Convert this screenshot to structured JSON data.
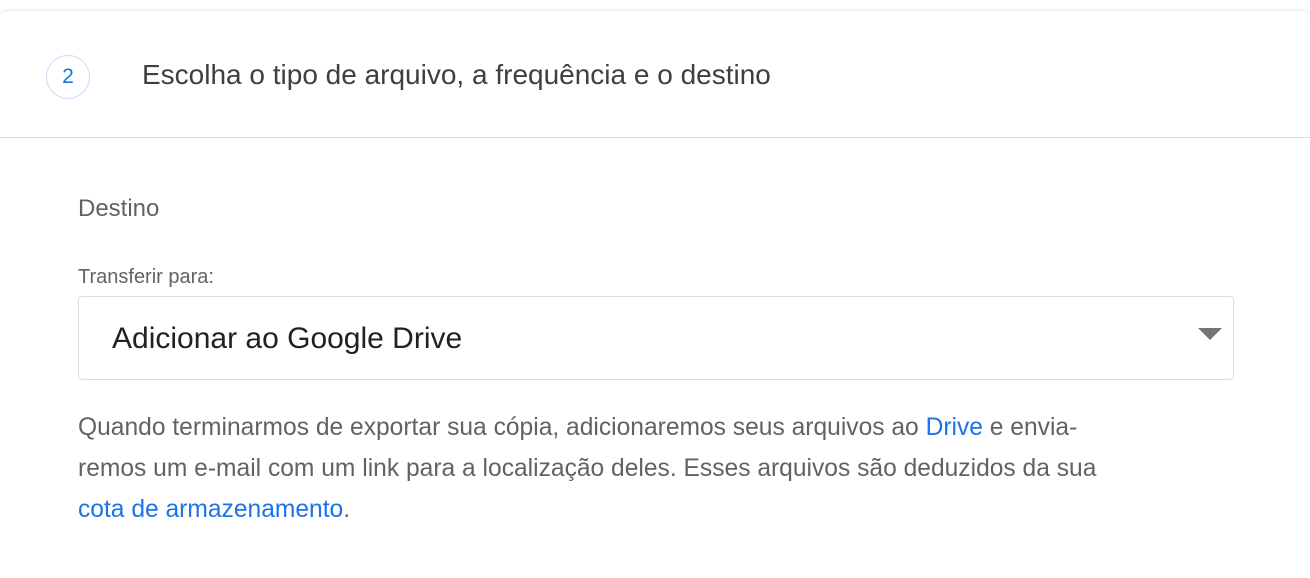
{
  "step": {
    "number": "2",
    "title": "Escolha o tipo de arquivo, a frequência e o destino"
  },
  "destination": {
    "section_title": "Destino",
    "field_label": "Transferir para:",
    "selected_option": "Adicionar ao Google Drive",
    "caret_icon": "caret-down-icon",
    "description": {
      "line1_before_link": "Quando terminarmos de exportar sua cópia, adicionaremos seus arquivos ao ",
      "drive_link": "Drive",
      "line1_after_link": " e envia-",
      "line2": "remos um e-mail com um link para a localização deles. Esses arquivos são deduzidos da sua",
      "storage_link": "cota de armazenamento",
      "line3_after_link": "."
    }
  },
  "colors": {
    "accent": "#1a73e8",
    "title_text": "#3c4043",
    "secondary_text": "#5f6368",
    "border": "#dadce0",
    "caret": "#757575"
  }
}
